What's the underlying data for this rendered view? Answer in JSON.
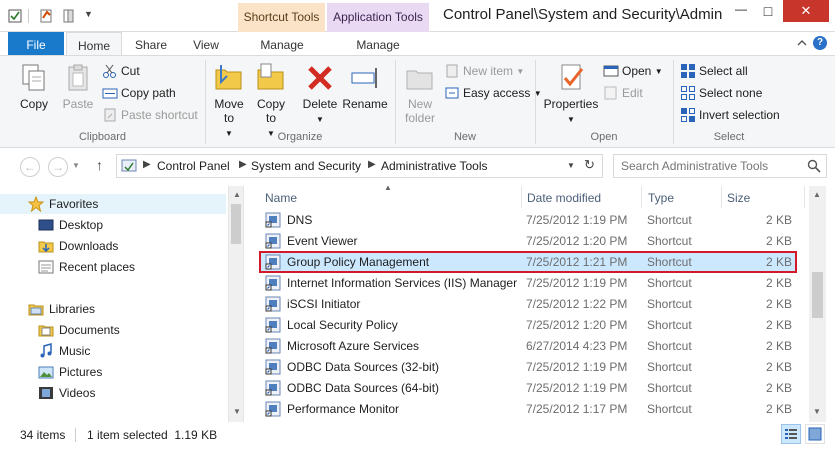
{
  "titlebar": {
    "context_tabs": [
      "Shortcut Tools",
      "Application Tools"
    ],
    "title": "Control Panel\\System and Security\\Administrative Tools",
    "minimize": "—",
    "maximize": "□",
    "close": "✕"
  },
  "tabs": {
    "file": "File",
    "home": "Home",
    "share": "Share",
    "view": "View",
    "manage1": "Manage",
    "manage2": "Manage"
  },
  "ribbon": {
    "clipboard": {
      "label": "Clipboard",
      "copy": "Copy",
      "paste": "Paste",
      "cut": "Cut",
      "copy_path": "Copy path",
      "paste_shortcut": "Paste shortcut"
    },
    "organize": {
      "label": "Organize",
      "move_to": "Move to",
      "copy_to": "Copy to",
      "delete": "Delete",
      "rename": "Rename"
    },
    "new": {
      "label": "New",
      "new_folder": "New folder",
      "new_item": "New item",
      "easy_access": "Easy access"
    },
    "open": {
      "label": "Open",
      "properties": "Properties",
      "open": "Open",
      "edit": "Edit"
    },
    "select": {
      "label": "Select",
      "select_all": "Select all",
      "select_none": "Select none",
      "invert_selection": "Invert selection"
    }
  },
  "address": {
    "crumbs": [
      "Control Panel",
      "System and Security",
      "Administrative Tools"
    ],
    "search_placeholder": "Search Administrative Tools"
  },
  "navpane": {
    "favorites": "Favorites",
    "favorites_items": [
      "Desktop",
      "Downloads",
      "Recent places"
    ],
    "libraries": "Libraries",
    "libraries_items": [
      "Documents",
      "Music",
      "Pictures",
      "Videos"
    ]
  },
  "columns": {
    "name": "Name",
    "date": "Date modified",
    "type": "Type",
    "size": "Size"
  },
  "files": [
    {
      "name": "DNS",
      "date": "7/25/2012 1:19 PM",
      "type": "Shortcut",
      "size": "2 KB"
    },
    {
      "name": "Event Viewer",
      "date": "7/25/2012 1:20 PM",
      "type": "Shortcut",
      "size": "2 KB"
    },
    {
      "name": "Group Policy Management",
      "date": "7/25/2012 1:21 PM",
      "type": "Shortcut",
      "size": "2 KB"
    },
    {
      "name": "Internet Information Services (IIS) Manager",
      "date": "7/25/2012 1:19 PM",
      "type": "Shortcut",
      "size": "2 KB"
    },
    {
      "name": "iSCSI Initiator",
      "date": "7/25/2012 1:22 PM",
      "type": "Shortcut",
      "size": "2 KB"
    },
    {
      "name": "Local Security Policy",
      "date": "7/25/2012 1:20 PM",
      "type": "Shortcut",
      "size": "2 KB"
    },
    {
      "name": "Microsoft Azure Services",
      "date": "6/27/2014 4:23 PM",
      "type": "Shortcut",
      "size": "2 KB"
    },
    {
      "name": "ODBC Data Sources (32-bit)",
      "date": "7/25/2012 1:19 PM",
      "type": "Shortcut",
      "size": "2 KB"
    },
    {
      "name": "ODBC Data Sources (64-bit)",
      "date": "7/25/2012 1:19 PM",
      "type": "Shortcut",
      "size": "2 KB"
    },
    {
      "name": "Performance Monitor",
      "date": "7/25/2012 1:17 PM",
      "type": "Shortcut",
      "size": "2 KB"
    }
  ],
  "status": {
    "items": "34 items",
    "selected": "1 item selected  1.19 KB"
  },
  "colors": {
    "file_tab": "#1979ca",
    "selection": "#cce8ff",
    "selection_outline": "#d2192b",
    "shortcut_tools": "#fbe3c7",
    "application_tools": "#e9d9f2"
  }
}
